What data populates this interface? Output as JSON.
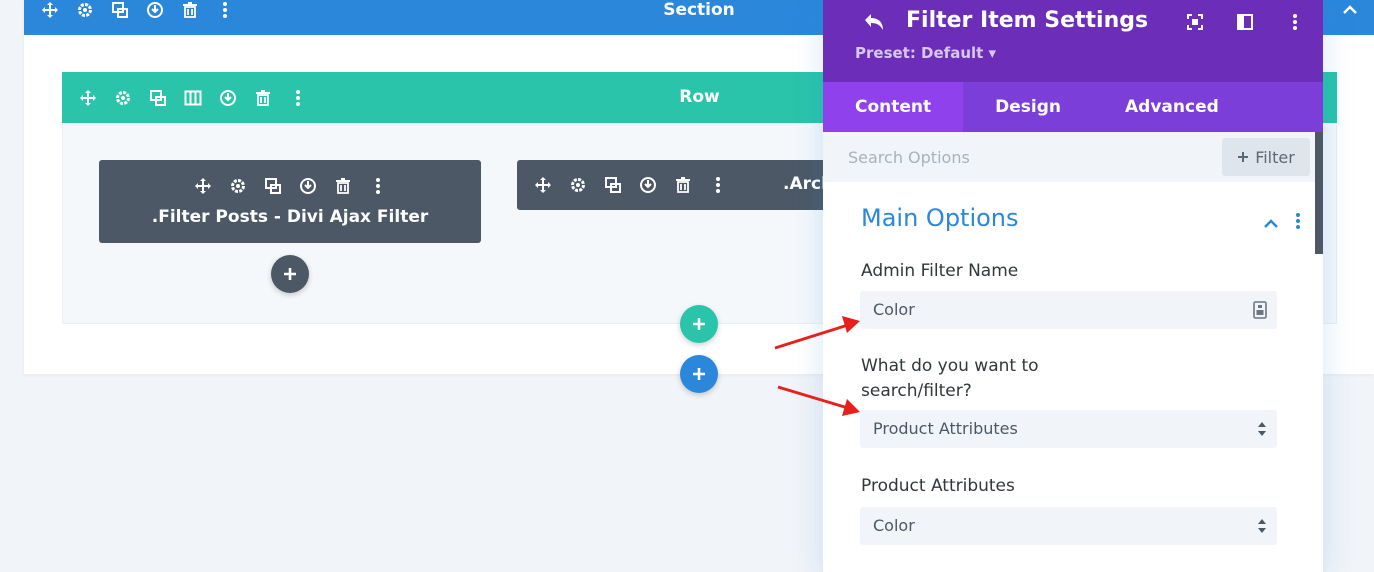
{
  "section": {
    "title": "Section"
  },
  "row": {
    "title": "Row"
  },
  "modules": [
    {
      "label": ".Filter Posts - Divi Ajax Filter"
    },
    {
      "label": ".Arch"
    }
  ],
  "colors": {
    "section": "#2b87da",
    "row": "#29c4a9",
    "module": "#4c5866",
    "panel_header": "#6c2eb9",
    "panel_tabs": "#7b3ed9",
    "accent_text": "#2b87da",
    "arrow": "#e8201c"
  },
  "panel": {
    "title": "Filter Item Settings",
    "preset": "Preset: Default ▾",
    "tabs": [
      {
        "label": "Content",
        "active": true
      },
      {
        "label": "Design",
        "active": false
      },
      {
        "label": "Advanced",
        "active": false
      }
    ],
    "search": {
      "placeholder": "Search Options",
      "filter_label": "Filter"
    },
    "group_title": "Main Options",
    "fields": [
      {
        "label": "Admin Filter Name",
        "value": "Color",
        "type": "text"
      },
      {
        "label": "What do you want to search/filter?",
        "label_line1": "What do you want to",
        "label_line2": "search/filter?",
        "value": "Product Attributes",
        "type": "select"
      },
      {
        "label": "Product Attributes",
        "value": "Color",
        "type": "select"
      }
    ]
  }
}
